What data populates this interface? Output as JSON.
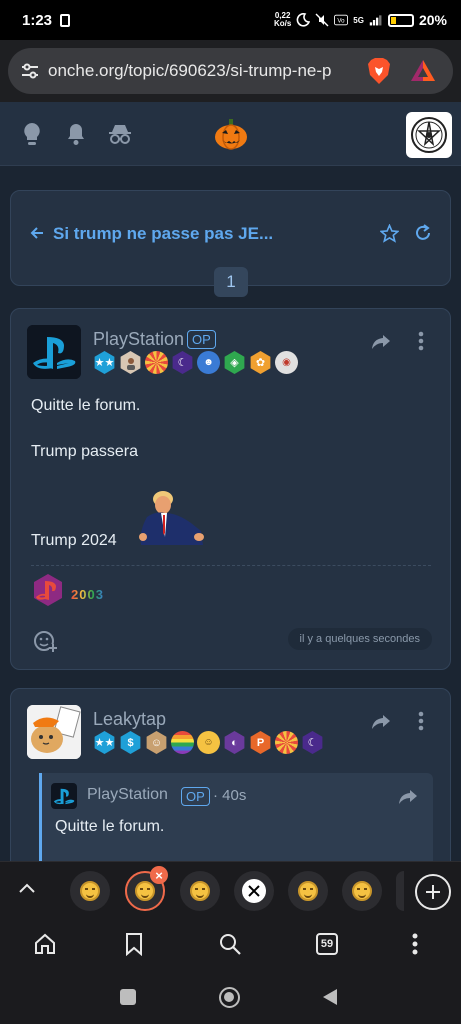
{
  "status_bar": {
    "time": "1:23",
    "speed_value": "0,22",
    "speed_unit": "Ko/s",
    "network": "5G",
    "battery": "20%"
  },
  "browser": {
    "url": "onche.org/topic/690623/si-trump-ne-p",
    "icons": [
      "tune-icon",
      "brave-lion-icon",
      "brave-rewards-icon"
    ]
  },
  "site_header": {
    "icons": [
      "lightbulb-icon",
      "bell-icon",
      "incognito-icon",
      "pumpkin-icon",
      "site-logo"
    ]
  },
  "topic": {
    "title": "Si trump ne passe pas JE...",
    "current_page": "1"
  },
  "posts": [
    {
      "author": "PlayStation",
      "op_badge": "OP",
      "lines": [
        "Quitte le forum.",
        "Trump passera",
        "Trump 2024"
      ],
      "reaction_label": "2003",
      "timestamp": "il y a quelques secondes"
    },
    {
      "author": "Leakytap",
      "quote": {
        "author": "PlayStation",
        "op_badge": "OP",
        "time": "· 40s",
        "text": "Quitte le forum."
      }
    }
  ],
  "tab_strip": {
    "tab_count": "59"
  },
  "colors": {
    "accent": "#5fa8ee",
    "card_bg": "#253243",
    "page_bg": "#1b2532"
  }
}
